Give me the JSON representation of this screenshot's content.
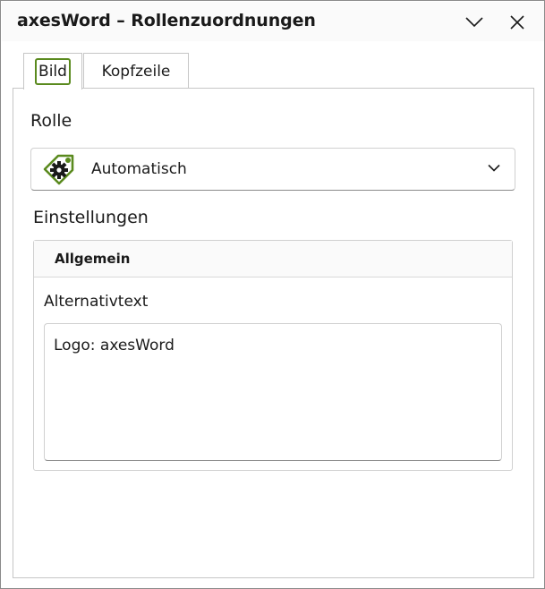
{
  "window": {
    "title": "axesWord – Rollenzuordnungen",
    "collapse_icon": "chevron-down-icon",
    "close_icon": "close-icon"
  },
  "tabs": [
    {
      "label": "Bild",
      "selected": true
    },
    {
      "label": "Kopfzeile",
      "selected": false
    }
  ],
  "role": {
    "label": "Rolle",
    "selected_value": "Automatisch",
    "icon": "tag-gear-icon"
  },
  "settings": {
    "label": "Einstellungen",
    "group_title": "Allgemein",
    "alt_text_label": "Alternativtext",
    "alt_text_value": "Logo: axesWord"
  },
  "colors": {
    "accent_green": "#5a8a1e",
    "border": "#c6c6c6"
  }
}
